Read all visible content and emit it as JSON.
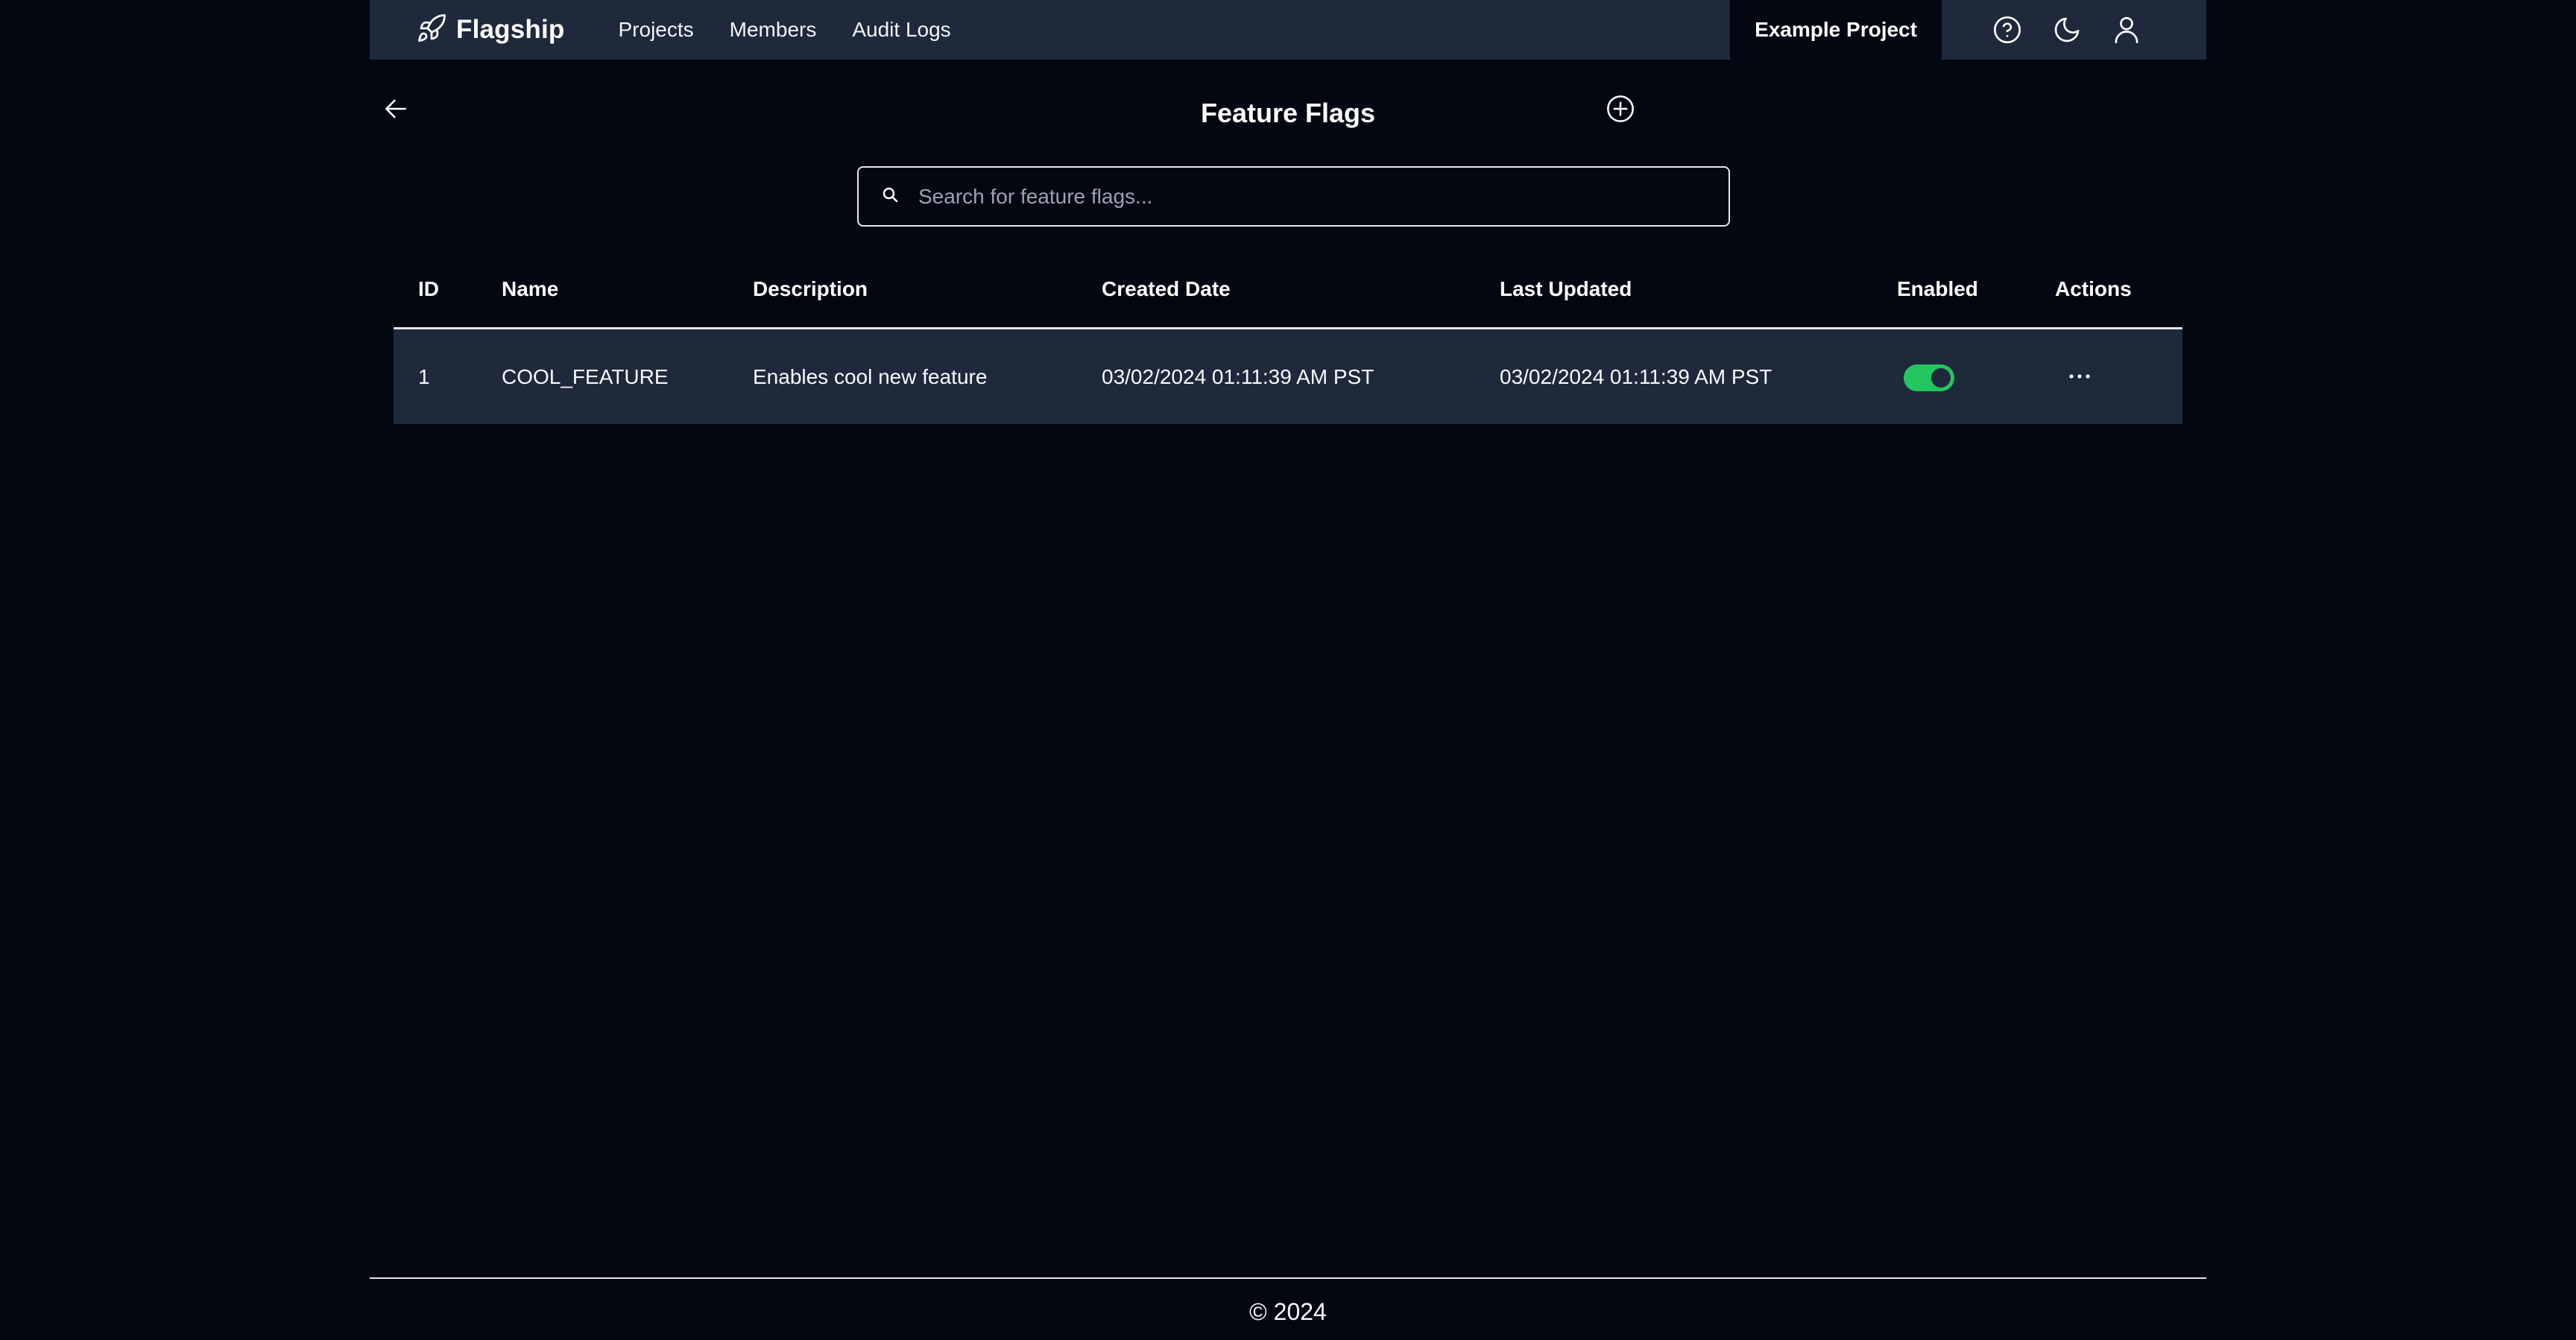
{
  "navbar": {
    "brand": "Flagship",
    "brand_icon": "rocket-icon",
    "links": [
      {
        "label": "Projects"
      },
      {
        "label": "Members"
      },
      {
        "label": "Audit Logs"
      }
    ],
    "project_name": "Example Project",
    "icons": [
      "help-icon",
      "moon-icon",
      "user-icon"
    ]
  },
  "page": {
    "title": "Feature Flags",
    "back_icon": "arrow-left-icon",
    "add_icon": "plus-circle-icon"
  },
  "search": {
    "placeholder": "Search for feature flags...",
    "value": ""
  },
  "table": {
    "columns": [
      "ID",
      "Name",
      "Description",
      "Created Date",
      "Last Updated",
      "Enabled",
      "Actions"
    ],
    "rows": [
      {
        "id": "1",
        "name": "COOL_FEATURE",
        "description": "Enables cool new feature",
        "created": "03/02/2024 01:11:39 AM PST",
        "updated": "03/02/2024 01:11:39 AM PST",
        "enabled": true
      }
    ]
  },
  "footer": {
    "text": "© 2024"
  },
  "colors": {
    "background": "#030712",
    "navbar": "#1e293b",
    "row": "#1e293b",
    "toggle_on": "#22c55e",
    "border": "#e5e7eb"
  }
}
